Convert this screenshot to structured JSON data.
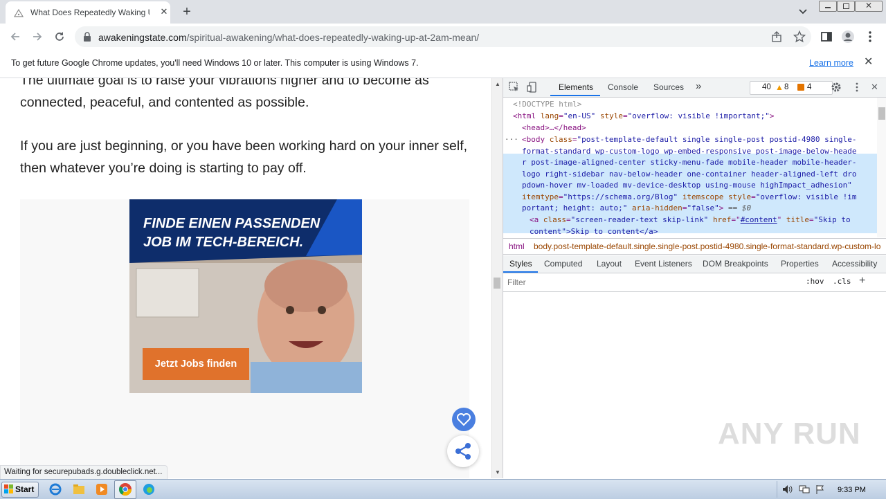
{
  "browser": {
    "tab_title": "What Does Repeatedly Waking Up a",
    "url_domain": "awakeningstate.com",
    "url_path": "/spiritual-awakening/what-does-repeatedly-waking-up-at-2am-mean/",
    "infobar_text": "To get future Google Chrome updates, you'll need Windows 10 or later. This computer is using Windows 7.",
    "infobar_link": "Learn more",
    "status_text": "Waiting for securepubads.g.doubleclick.net..."
  },
  "page": {
    "para1": "The ultimate goal is to raise your vibrations higher and to become as connected, peaceful, and contented as possible.",
    "para2": "If you are just beginning, or you have been working hard on your inner self, then whatever you’re doing is starting to pay off.",
    "ad_headline_1": "FINDE EINEN PASSENDEN",
    "ad_headline_2": "JOB IM TECH-BEREICH.",
    "ad_cta": "Jetzt Jobs finden"
  },
  "devtools": {
    "tabs": [
      "Elements",
      "Console",
      "Sources"
    ],
    "more": "»",
    "count_info": "40",
    "count_warn": "8",
    "count_issue": "4",
    "elements": {
      "doctype": "<!DOCTYPE html>",
      "html_open_tag": "<html",
      "html_lang_attr": "lang",
      "html_lang_val": "\"en-US\"",
      "html_style_attr": "style",
      "html_style_val": "\"overflow: visible !important;\"",
      "html_close": ">",
      "head": "<head>…</head>",
      "dots": "···",
      "body_tag": "<body",
      "body_class_attr": "class",
      "body_line1": "\"post-template-default single single-post postid-4980 single-",
      "body_line2": "format-standard wp-custom-logo wp-embed-responsive post-image-below-heade",
      "body_line3": "r post-image-aligned-center sticky-menu-fade mobile-header mobile-header-",
      "body_line4": "logo right-sidebar nav-below-header one-container header-aligned-left dro",
      "body_line5": "pdown-hover mv-loaded mv-device-desktop using-mouse highImpact_adhesion\"",
      "body_itemtype_attr": "itemtype",
      "body_itemtype_val": "\"https://schema.org/Blog\"",
      "body_itemscope_attr": "itemscope",
      "body_style_attr": "style",
      "body_style_val1": "\"overflow: visible !im",
      "body_style_val2": "portant; height: auto;\"",
      "body_aria_attr": "aria-hidden",
      "body_aria_val": "\"false\"",
      "body_eq": "== $0",
      "a_tag": "<a",
      "a_class_attr": "class",
      "a_class_val": "\"screen-reader-text skip-link\"",
      "a_href_attr": "href",
      "a_href_val": "#content",
      "a_title_attr": "title",
      "a_title_val": "\"Skip to",
      "a_line2": "content\">Skip to content</a>"
    },
    "breadcrumb_html": "html",
    "breadcrumb_body": "body.post-template-default.single.single-post.postid-4980.single-format-standard.wp-custom-lo",
    "styles_tabs": [
      "Styles",
      "Computed",
      "Layout",
      "Event Listeners",
      "DOM Breakpoints",
      "Properties",
      "Accessibility"
    ],
    "filter_placeholder": "Filter",
    "hov": ":hov",
    "cls": ".cls",
    "plus": "+"
  },
  "taskbar": {
    "start_label": "Start",
    "clock": "9:33 PM"
  },
  "watermark": "ANY RUN"
}
